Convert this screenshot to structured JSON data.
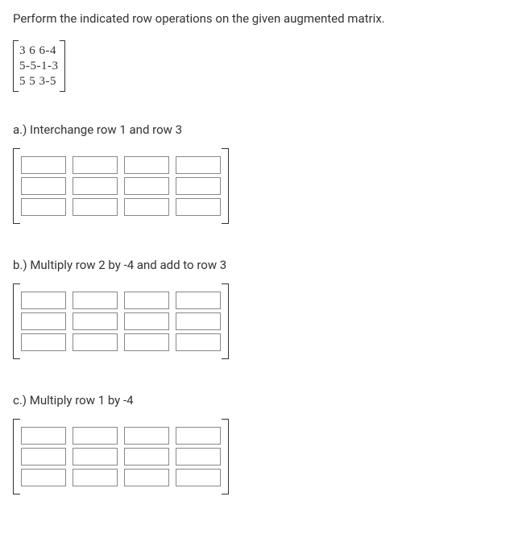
{
  "instruction": "Perform the indicated row operations on the given augmented matrix.",
  "given_matrix": {
    "rows": [
      "3 6 6-4",
      "5-5-1-3",
      "5 5 3-5"
    ]
  },
  "parts": [
    {
      "id": "a",
      "label": "a.) Interchange row 1 and row 3",
      "rows": 3,
      "cols": 4
    },
    {
      "id": "b",
      "label": "b.) Multiply row 2 by -4 and add to row 3",
      "rows": 3,
      "cols": 4
    },
    {
      "id": "c",
      "label": "c.) Multiply row 1 by -4",
      "rows": 3,
      "cols": 4
    }
  ]
}
